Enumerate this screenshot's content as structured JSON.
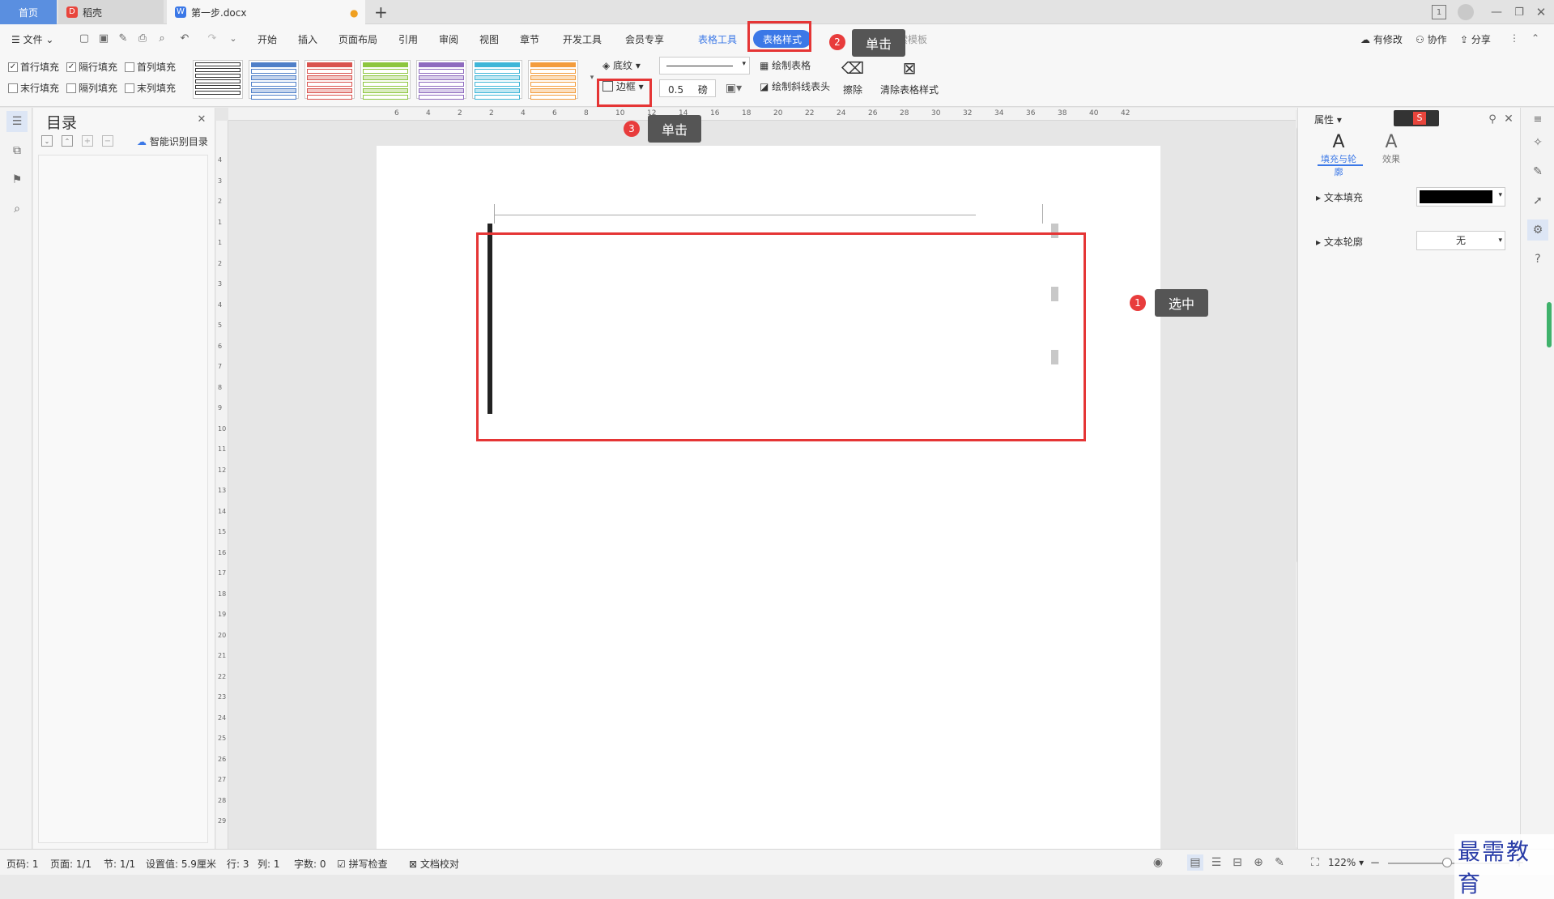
{
  "tabs": {
    "home": "首页",
    "daoke": "稻壳",
    "doc": "第一步.docx",
    "add": "+"
  },
  "menu": {
    "file": "文件",
    "items": [
      "开始",
      "插入",
      "页面布局",
      "引用",
      "审阅",
      "视图",
      "章节",
      "开发工具",
      "会员专享"
    ],
    "table_tools": "表格工具",
    "table_style": "表格样式",
    "search_tpl": "搜索模板",
    "modified": "有修改",
    "collab": "协作",
    "share": "分享"
  },
  "ribbon": {
    "checks": [
      {
        "label": "首行填充",
        "checked": true
      },
      {
        "label": "隔行填充",
        "checked": true
      },
      {
        "label": "首列填充",
        "checked": false
      },
      {
        "label": "末行填充",
        "checked": false
      },
      {
        "label": "隔列填充",
        "checked": false
      },
      {
        "label": "末列填充",
        "checked": false
      }
    ],
    "shading": "底纹",
    "border": "边框",
    "line_weight": "0.5",
    "line_unit": "磅",
    "draw_table": "绘制表格",
    "draw_diag": "绘制斜线表头",
    "erase": "擦除",
    "clear_style": "清除表格样式"
  },
  "gallery_colors": [
    "#333333",
    "#4f7fc8",
    "#d9534f",
    "#8dc63f",
    "#8e6bbf",
    "#3fb6d8",
    "#f39c3d"
  ],
  "toc": {
    "title": "目录",
    "smart": "智能识别目录"
  },
  "right": {
    "props": "属性",
    "fill_outline": "填充与轮廓",
    "effect": "效果",
    "text_fill": "文本填充",
    "text_outline": "文本轮廓",
    "outline_value": "无"
  },
  "annotations": [
    {
      "num": "1",
      "text": "选中"
    },
    {
      "num": "2",
      "text": "单击"
    },
    {
      "num": "3",
      "text": "单击"
    }
  ],
  "ruler_h": [
    "6",
    "4",
    "2",
    "2",
    "4",
    "6",
    "8",
    "10",
    "12",
    "14",
    "16",
    "18",
    "20",
    "22",
    "24",
    "26",
    "28",
    "30",
    "32",
    "34",
    "36",
    "38",
    "40",
    "42"
  ],
  "ruler_v": [
    "4",
    "3",
    "2",
    "1",
    "1",
    "2",
    "3",
    "4",
    "5",
    "6",
    "7",
    "8",
    "9",
    "10",
    "11",
    "12",
    "13",
    "14",
    "15",
    "16",
    "17",
    "18",
    "19",
    "20",
    "21",
    "22",
    "23",
    "24",
    "25",
    "26",
    "27",
    "28",
    "29"
  ],
  "status": {
    "page": "页码: 1",
    "pages": "页面: 1/1",
    "section": "节: 1/1",
    "setting": "设置值: 5.9厘米",
    "row": "行: 3",
    "col": "列: 1",
    "words": "字数: 0",
    "spell": "拼写检查",
    "proof": "文档校对",
    "zoom": "122%"
  },
  "watermark": "最需教育"
}
